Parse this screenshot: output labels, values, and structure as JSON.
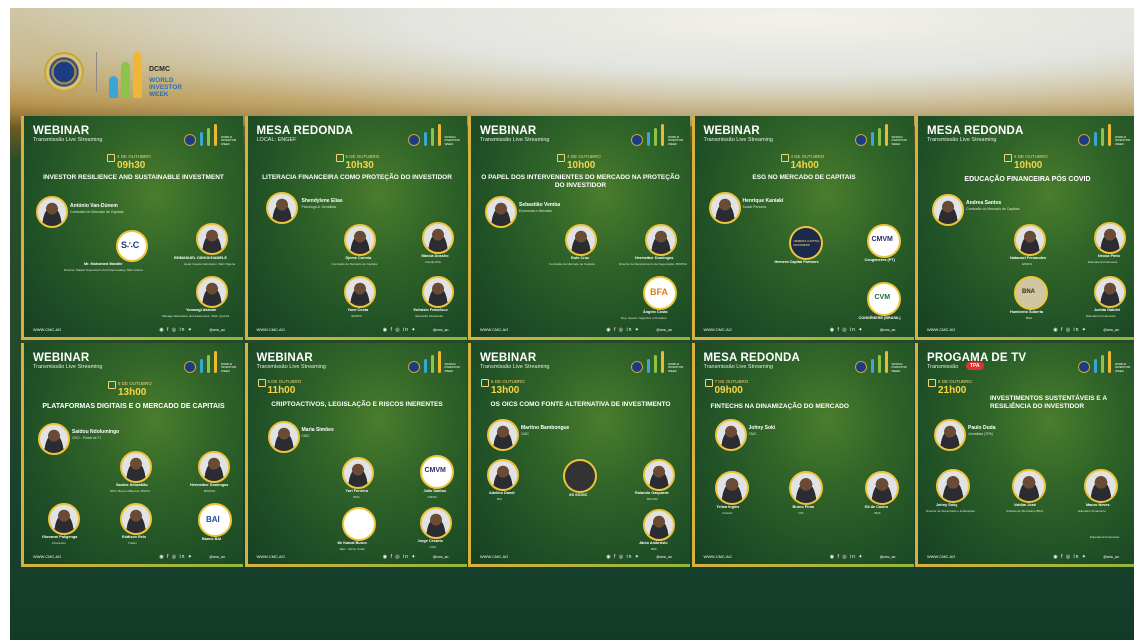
{
  "header": {
    "dcmc_logo_text": "DCMC",
    "wiw_lines": [
      "WORLD",
      "INVESTOR",
      "WEEK"
    ]
  },
  "cards": [
    {
      "type": "WEBINAR",
      "sub": "Transmissão Live Streaming",
      "date": "4 DE OUTUBRO",
      "time": "09h30",
      "title": "INVESTOR RESILIENCE AND SUSTAINABLE INVESTMENT",
      "host": {
        "name": "António Van-Dúnem",
        "role": "Comissão do Mercado de Capitais"
      },
      "p1": {
        "name": "Mr. Mohamed Mandle",
        "role": "Director, Market Supervision And Intermediary, SEC Ghana"
      },
      "p2": {
        "name": "EMMANUEL OSHOKHAMELE",
        "role": "Head Investor Education, SEC Nigeria"
      },
      "p3": {
        "name": "Yonmagi Akande",
        "role": "Manager Education and Awareness, CMA, Quénia"
      },
      "web": "WWW.CMC.AO",
      "handle": "@cmc_ao"
    },
    {
      "type": "MESA REDONDA",
      "sub": "LOCAL: ENGEF",
      "date": "5 DE OUTUBRO",
      "time": "10h30",
      "title": "LITERACIA FINANCEIRA COMO PROTEÇÃO DO INVESTIDOR",
      "host": {
        "name": "Shendylene Elias",
        "role": "Psicóloga & Jornalista"
      },
      "p1": {
        "name": "Djeme Correia",
        "role": "Comissão do Mercado de Capitais"
      },
      "p2": {
        "name": "Márcia Dossho",
        "role": "Kandu-Phio"
      },
      "p3": {
        "name": "Yone Costa",
        "role": "ENSFS"
      },
      "p4": {
        "name": "Eufrásio Francisco",
        "role": "Educador Financeiro"
      },
      "web": "WWW.CMC.AO",
      "handle": "@cmc_ao"
    },
    {
      "type": "WEBINAR",
      "sub": "Transmissão Live Streaming",
      "date": "4 DE OUTUBRO",
      "time": "10h00",
      "title": "O PAPEL DOS INTERVENIENTES DO MERCADO NA PROTEÇÃO DO INVESTIDOR",
      "host": {
        "name": "Sebastião Vemba",
        "role": "Economia e Mercado"
      },
      "p1": {
        "name": "Rute Cruz",
        "role": "Comissão do Mercado de Capitais"
      },
      "p2": {
        "name": "Hermeíber Domingos",
        "role": "Director de Departamento de Negociação, BODIVA"
      },
      "p3": {
        "name": "Ângelo Costa",
        "role": "Dep. Gestor. Negócios e Produtos"
      },
      "web": "WWW.CMC.AO",
      "handle": "@cmc_ao"
    },
    {
      "type": "WEBINAR",
      "sub": "Transmissão Live Streaming",
      "date": "4 DE OUTUBRO",
      "time": "14h00",
      "title": "ESG NO MERCADO DE CAPITAIS",
      "host": {
        "name": "Henrique Kaniakí",
        "role": "Social Persona"
      },
      "p1": {
        "name": "Hemera Capital Partners",
        "role": ""
      },
      "p2": {
        "name": "Congéneres (PT)",
        "role": ""
      },
      "p3": {
        "name": "CONGÉNERE (BRASIL)",
        "role": ""
      },
      "web": "WWW.CMC.AO",
      "handle": "@cmc_ao"
    },
    {
      "type": "MESA REDONDA",
      "sub": "Transmissão Live Streaming",
      "date": "5 DE OUTUBRO",
      "time": "10h00",
      "title": "EDUCAÇÃO FINANCEIRA PÓS COVID",
      "host": {
        "name": "Andrea Santos",
        "role": "Comissão do Mercado de Capitais"
      },
      "p1": {
        "name": "Natanael Fernandes",
        "role": "ENSFS"
      },
      "p2": {
        "name": "Neusa Pinto",
        "role": "Educadora Financeira"
      },
      "p3": {
        "name": "Humberto Soberta",
        "role": "BNA"
      },
      "p4": {
        "name": "Juelda Gabriel",
        "role": "Educadora Financeira"
      },
      "web": "WWW.CMC.AO",
      "handle": "@cmc_ao"
    },
    {
      "type": "WEBINAR",
      "sub": "Transmissão Live Streaming",
      "date": "5 DE OUTUBRO",
      "time": "13h00",
      "title": "PLATAFORMAS DIGITAIS E O MERCADO DE CAPITAIS",
      "host": {
        "name": "Saidou Ndolumingo",
        "role": "CEO - Portal de TI"
      },
      "p1": {
        "name": "Santos Sebastião",
        "role": "DPO, Banco Millenium BCP/A"
      },
      "p2": {
        "name": "Hermeíber Domingos",
        "role": "BODIVA"
      },
      "p3": {
        "name": "Giovanni Paligenga",
        "role": "Financeiro"
      },
      "p4": {
        "name": "Eddison Reis",
        "role": "Trader"
      },
      "p5": {
        "name": "Banco BAI",
        "role": ""
      },
      "web": "WWW.CMC.AO",
      "handle": "@cmc_ao"
    },
    {
      "type": "WEBINAR",
      "sub": "Transmissão Live Streaming",
      "date": "6 DE OUTUBRO",
      "time": "11h00",
      "title": "CRIPTOACTIVOS, LEGISLAÇÃO E RISCOS INERENTES",
      "host": {
        "name": "Maria Simões",
        "role": "CMC"
      },
      "p1": {
        "name": "Yuri Ferreira",
        "role": "BNA"
      },
      "p2": {
        "name": "Julio Santos",
        "role": "CMVM"
      },
      "p3": {
        "name": "Mr Kamal Burun",
        "role": "SEC - Reino Unido"
      },
      "p4": {
        "name": "Jorge Cesário",
        "role": "UAN"
      },
      "web": "WWW.CMC.AO",
      "handle": "@cmc_ao"
    },
    {
      "type": "WEBINAR",
      "sub": "Transmissão Live Streaming",
      "date": "6 DE OUTUBRO",
      "time": "13h00",
      "title": "OS OICS COMO FONTE ALTERNATIVA DE INVESTIMENTO",
      "host": {
        "name": "Martino Bambongue",
        "role": "CMC"
      },
      "p1": {
        "name": "Adelino Dandi",
        "role": "BAI"
      },
      "p2": {
        "name": "XS SGOIC",
        "role": ""
      },
      "p3": {
        "name": "Rolando Gasparde",
        "role": "BFA AM"
      },
      "p4": {
        "name": "Jânio Ambrósio",
        "role": "BDF"
      },
      "web": "WWW.CMC.AO",
      "handle": "@cmc_ao"
    },
    {
      "type": "MESA REDONDA",
      "sub": "Transmissão Live Streaming",
      "date": "7 DE OUTUBRO",
      "time": "09h00",
      "title": "FINTECHS NA DINAMIZAÇÃO DO MERCADO",
      "host": {
        "name": "Johny Soki",
        "role": "CMC"
      },
      "p1": {
        "name": "Telma Ingles",
        "role": "Fintech"
      },
      "p2": {
        "name": "Bruno Pinto",
        "role": "DSI"
      },
      "p3": {
        "name": "Gil de Castro",
        "role": "BNA"
      },
      "web": "WWW.CMC.AO",
      "handle": "@cmc_ao"
    },
    {
      "type": "PROGAMA DE TV",
      "sub": "Transmissão",
      "date": "8 DE OUTUBRO",
      "time": "21h00",
      "badge": "TPA",
      "title": "INVESTIMENTOS SUSTENTÁVEIS E A RESILIÊNCIA DO INVESTIDOR",
      "host": {
        "name": "Paulo Duda",
        "role": "Jornalista (TPA)"
      },
      "p1": {
        "name": "Johny Soky",
        "role": "Director de Supervisão e Instituições"
      },
      "p2": {
        "name": "Valdim José",
        "role": "Analista de Mercados (BFA)"
      },
      "p3": {
        "name": "Mauro Neves",
        "role": "Educador Financeiro"
      },
      "note": "Educadora Financeira",
      "web": "WWW.CMC.AO",
      "handle": "@cmc_ao"
    }
  ],
  "logos": {
    "cmvm": "CMVM",
    "cvm": "CVM",
    "bfa": "BFA",
    "bai": "BAI",
    "bna": "BNA",
    "hemera": "HEMERA CAPITAL PARTNERS",
    "ssc": "S∴C"
  },
  "colors": {
    "accent_gold": "#f6d44a",
    "card_green": "#2f6328",
    "frame_border": "#d6b23d"
  }
}
